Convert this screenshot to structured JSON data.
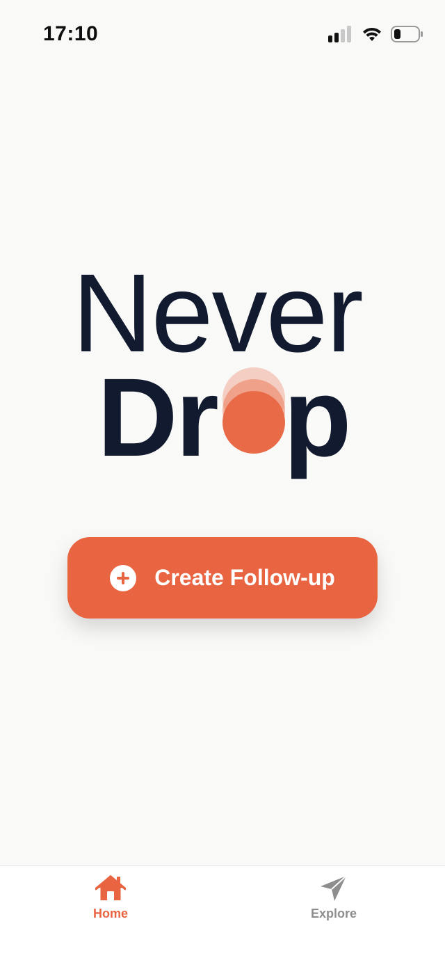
{
  "status_bar": {
    "time": "17:10",
    "icons": [
      "cellular-signal-icon",
      "wifi-icon",
      "battery-icon"
    ]
  },
  "logo": {
    "line1": "Never",
    "line2_prefix": "Dr",
    "line2_suffix": "p",
    "accent_color": "#e96542"
  },
  "create_button": {
    "label": "Create Follow-up",
    "icon": "plus-circle-icon"
  },
  "tab_bar": {
    "tabs": [
      {
        "label": "Home",
        "icon": "home-icon",
        "active": true
      },
      {
        "label": "Explore",
        "icon": "paper-plane-icon",
        "active": false
      }
    ]
  },
  "colors": {
    "accent": "#e96542",
    "text_dark": "#111a2e",
    "background": "#f9f9f8",
    "inactive": "#8e8e8e"
  }
}
